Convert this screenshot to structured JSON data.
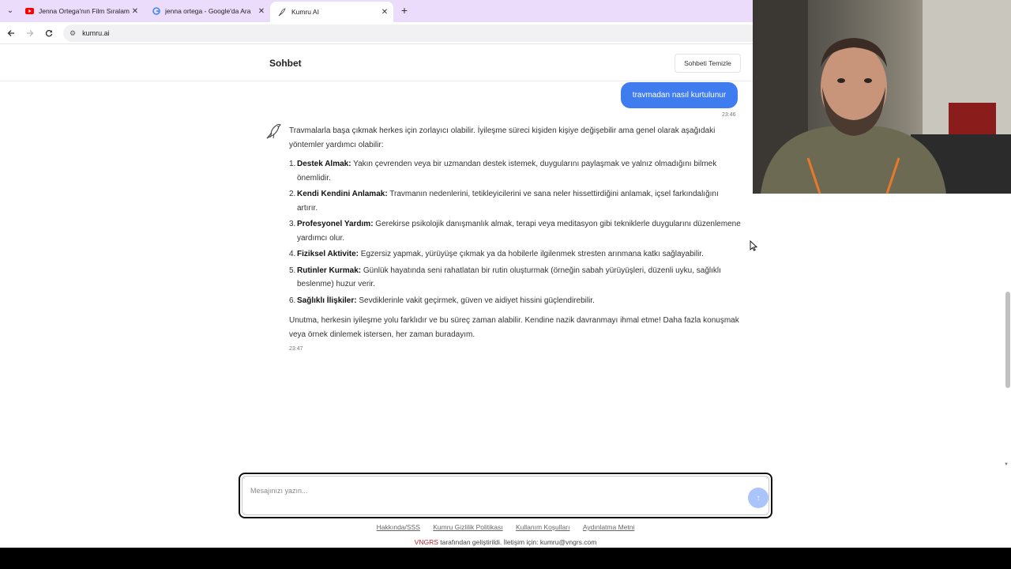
{
  "browser": {
    "tabs": [
      {
        "label": "Jenna Ortega'nın Film Sıralaması",
        "icon": "youtube-icon",
        "active": false
      },
      {
        "label": "jenna ortega - Google'da Ara",
        "icon": "google-icon",
        "active": false
      },
      {
        "label": "Kumru AI",
        "icon": "bird-icon",
        "active": true
      }
    ],
    "url": "kumru.ai"
  },
  "header": {
    "title": "Sohbet",
    "clear_button": "Sohbeti Temizle"
  },
  "chat": {
    "user_message": "travmadan nasıl kurtulunur",
    "user_time": "23:46",
    "bot": {
      "intro": "Travmalarla başa çıkmak herkes için zorlayıcı olabilir. İyileşme süreci kişiden kişiye değişebilir ama genel olarak aşağıdaki yöntemler yardımcı olabilir:",
      "items": [
        {
          "num": "1.",
          "title": "Destek Almak:",
          "text": " Yakın çevrenden veya bir uzmandan destek istemek, duygularını paylaşmak ve yalnız olmadığını bilmek önemlidir."
        },
        {
          "num": "2.",
          "title": "Kendi Kendini Anlamak:",
          "text": " Travmanın nedenlerini, tetikleyicilerini ve sana neler hissettirdiğini anlamak, içsel farkındalığını artırır."
        },
        {
          "num": "3.",
          "title": "Profesyonel Yardım:",
          "text": " Gerekirse psikolojik danışmanlık almak, terapi veya meditasyon gibi tekniklerle duygularını düzenlemene yardımcı olur."
        },
        {
          "num": "4.",
          "title": "Fiziksel Aktivite:",
          "text": " Egzersiz yapmak, yürüyüşe çıkmak ya da hobilerle ilgilenmek stresten arınmana katkı sağlayabilir."
        },
        {
          "num": "5.",
          "title": "Rutinler Kurmak:",
          "text": " Günlük hayatında seni rahatlatan bir rutin oluşturmak (örneğin sabah yürüyüşleri, düzenli uyku, sağlıklı beslenme) huzur verir."
        },
        {
          "num": "6.",
          "title": "Sağlıklı İlişkiler:",
          "text": " Sevdiklerinle vakit geçirmek, güven ve aidiyet hissini güçlendirebilir."
        }
      ],
      "outro": "Unutma, herkesin iyileşme yolu farklıdır ve bu süreç zaman alabilir. Kendine nazik davranmayı ihmal etme! Daha fazla konuşmak veya örnek dinlemek istersen, her zaman buradayım.",
      "time": "23:47"
    }
  },
  "input": {
    "placeholder": "Mesajınızı yazın...",
    "send_icon": "send-arrow-icon"
  },
  "footer": {
    "links": [
      "Hakkında/SSS",
      "Kumru Gizlilik Politikası",
      "Kullanım Koşulları",
      "Aydınlatma Metni"
    ],
    "brand": "VNGRS",
    "note": " tarafından geliştirildi. İletişim için: kumru@vngrs.com"
  },
  "colors": {
    "accent": "#3f7cf0",
    "send_button": "#a9c5fb",
    "tabstrip": "#ebdcfb",
    "brand": "#c0262d"
  }
}
